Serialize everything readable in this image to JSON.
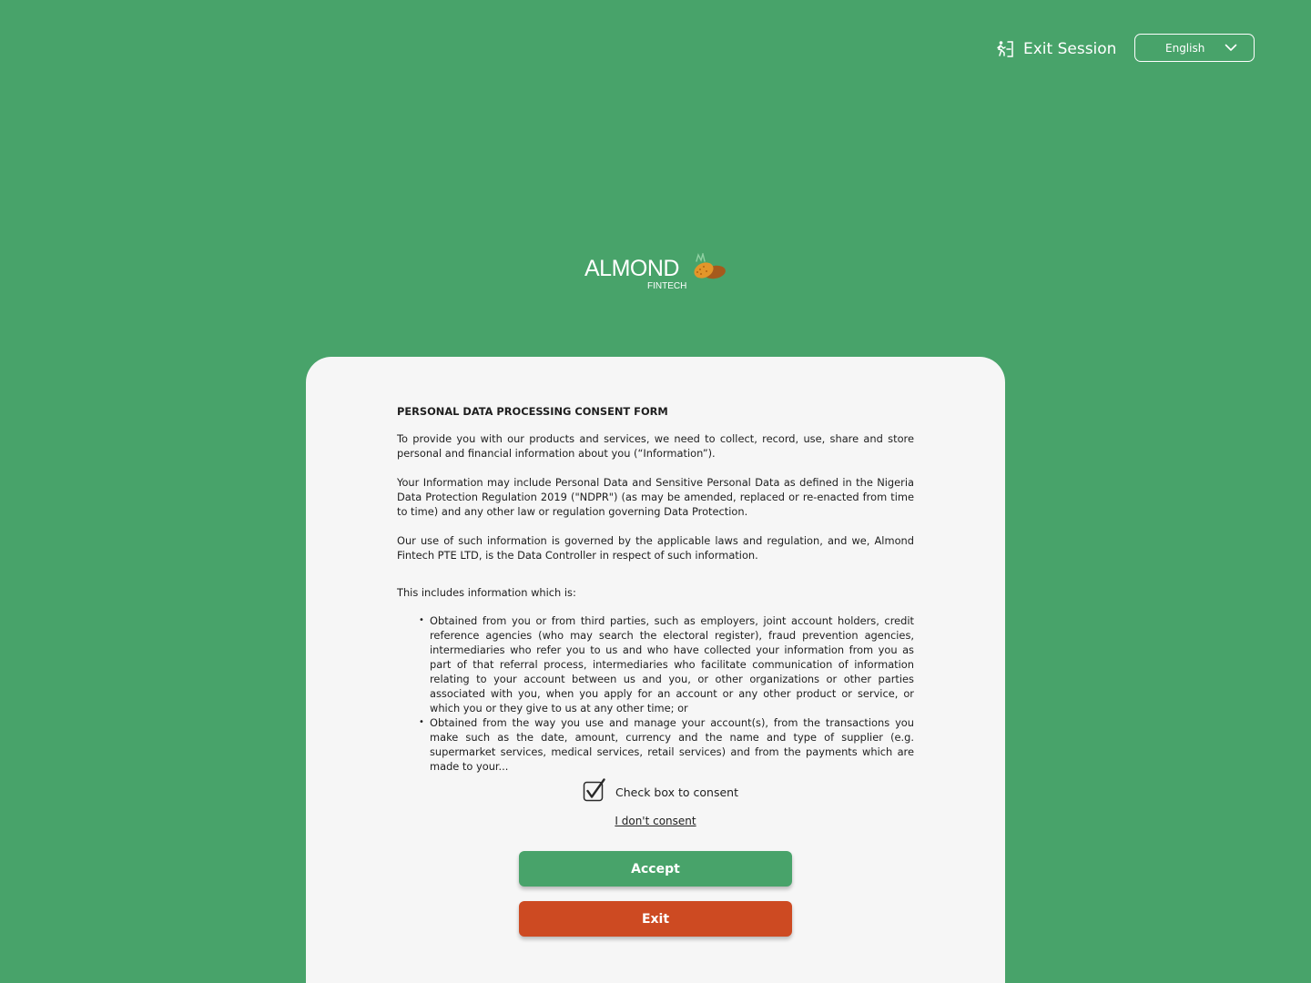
{
  "topbar": {
    "exit_session_label": "Exit Session",
    "exit_session_icon": "exit-session-icon",
    "language": {
      "selected": "English",
      "icon": "chevron-down-icon"
    }
  },
  "logo": {
    "wordmark": "ALMOND",
    "subtitle": "FINTECH"
  },
  "consent_form": {
    "title": "PERSONAL DATA PROCESSING CONSENT FORM",
    "paragraphs": [
      "To provide you with our products and services, we need to collect, record, use, share and store personal and financial information about you (“Information”).",
      "Your Information may include Personal Data and Sensitive Personal Data as defined in the Nigeria Data Protection Regulation 2019 (\"NDPR\") (as may be amended, replaced or re-enacted from time to time) and any other law or regulation governing Data Protection.",
      "Our use of such information is governed by the applicable laws and regulation, and we, Almond Fintech PTE LTD, is the Data Controller in respect of such information.",
      "This includes information which is:"
    ],
    "bullets": [
      "Obtained from you or from third parties, such as employers, joint account holders, credit reference agencies (who may search the electoral register), fraud prevention agencies, intermediaries who refer you to us and who have collected your information from you as part of that referral process, intermediaries who facilitate communication of information relating to your account between us and you, or other organizations or other parties associated with you, when you apply for an account or any other product or service, or which you or they give to us at any other time; or",
      "Obtained from the way you use and manage your account(s), from the transactions you make such as the date, amount, currency and the name and type of supplier (e.g. supermarket services, medical services, retail services) and from the payments which are made to your..."
    ],
    "checkbox_label": "Check box to consent",
    "checkbox_checked": true,
    "no_consent_link": "I don't consent",
    "accept_label": "Accept",
    "exit_label": "Exit"
  },
  "colors": {
    "background": "#48a36a",
    "card": "#f6f6f6",
    "accept": "#48a36a",
    "exit": "#cd4a22",
    "logo_accent": "#e3962a"
  }
}
